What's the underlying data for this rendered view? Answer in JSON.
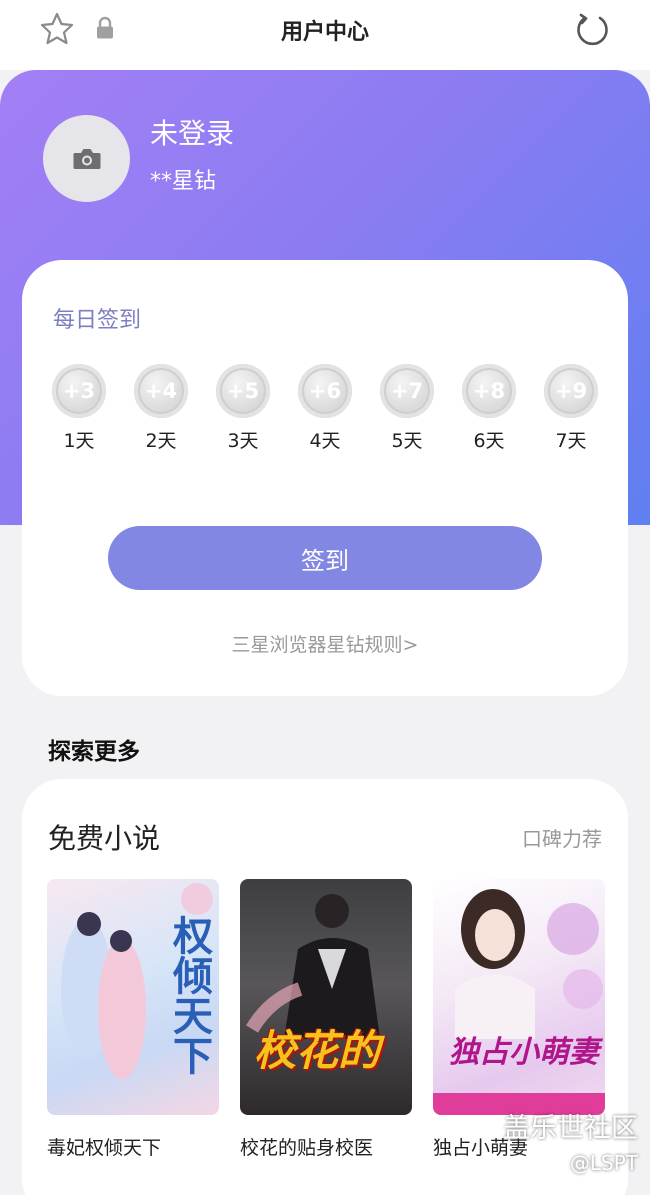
{
  "header": {
    "title": "用户中心",
    "star_icon": "star-outline-icon",
    "lock_icon": "lock-icon",
    "refresh_icon": "refresh-icon"
  },
  "profile": {
    "avatar_icon": "camera-icon",
    "name": "未登录",
    "stars": "**星钻"
  },
  "checkin": {
    "title": "每日签到",
    "days": [
      {
        "reward": "+3",
        "label": "1天"
      },
      {
        "reward": "+4",
        "label": "2天"
      },
      {
        "reward": "+5",
        "label": "3天"
      },
      {
        "reward": "+6",
        "label": "4天"
      },
      {
        "reward": "+7",
        "label": "5天"
      },
      {
        "reward": "+8",
        "label": "6天"
      },
      {
        "reward": "+9",
        "label": "7天"
      }
    ],
    "button_label": "签到",
    "rules_link": "三星浏览器星钻规则>"
  },
  "explore": {
    "title": "探索更多"
  },
  "novels": {
    "title": "免费小说",
    "more": "口碑力荐",
    "books": [
      {
        "name": "毒妃权倾天下",
        "cover_text": "权倾天下"
      },
      {
        "name": "校花的贴身校医",
        "cover_text": "校花的"
      },
      {
        "name": "独占小萌妻",
        "cover_text": "独占小萌妻"
      }
    ]
  },
  "watermark": {
    "line1": "盖乐世社区",
    "line2": "@LSPT"
  },
  "colors": {
    "hero_start": "#a37ff5",
    "hero_end": "#5f7ff0",
    "button": "#8187e2",
    "checkin_title": "#7c7fc0"
  }
}
